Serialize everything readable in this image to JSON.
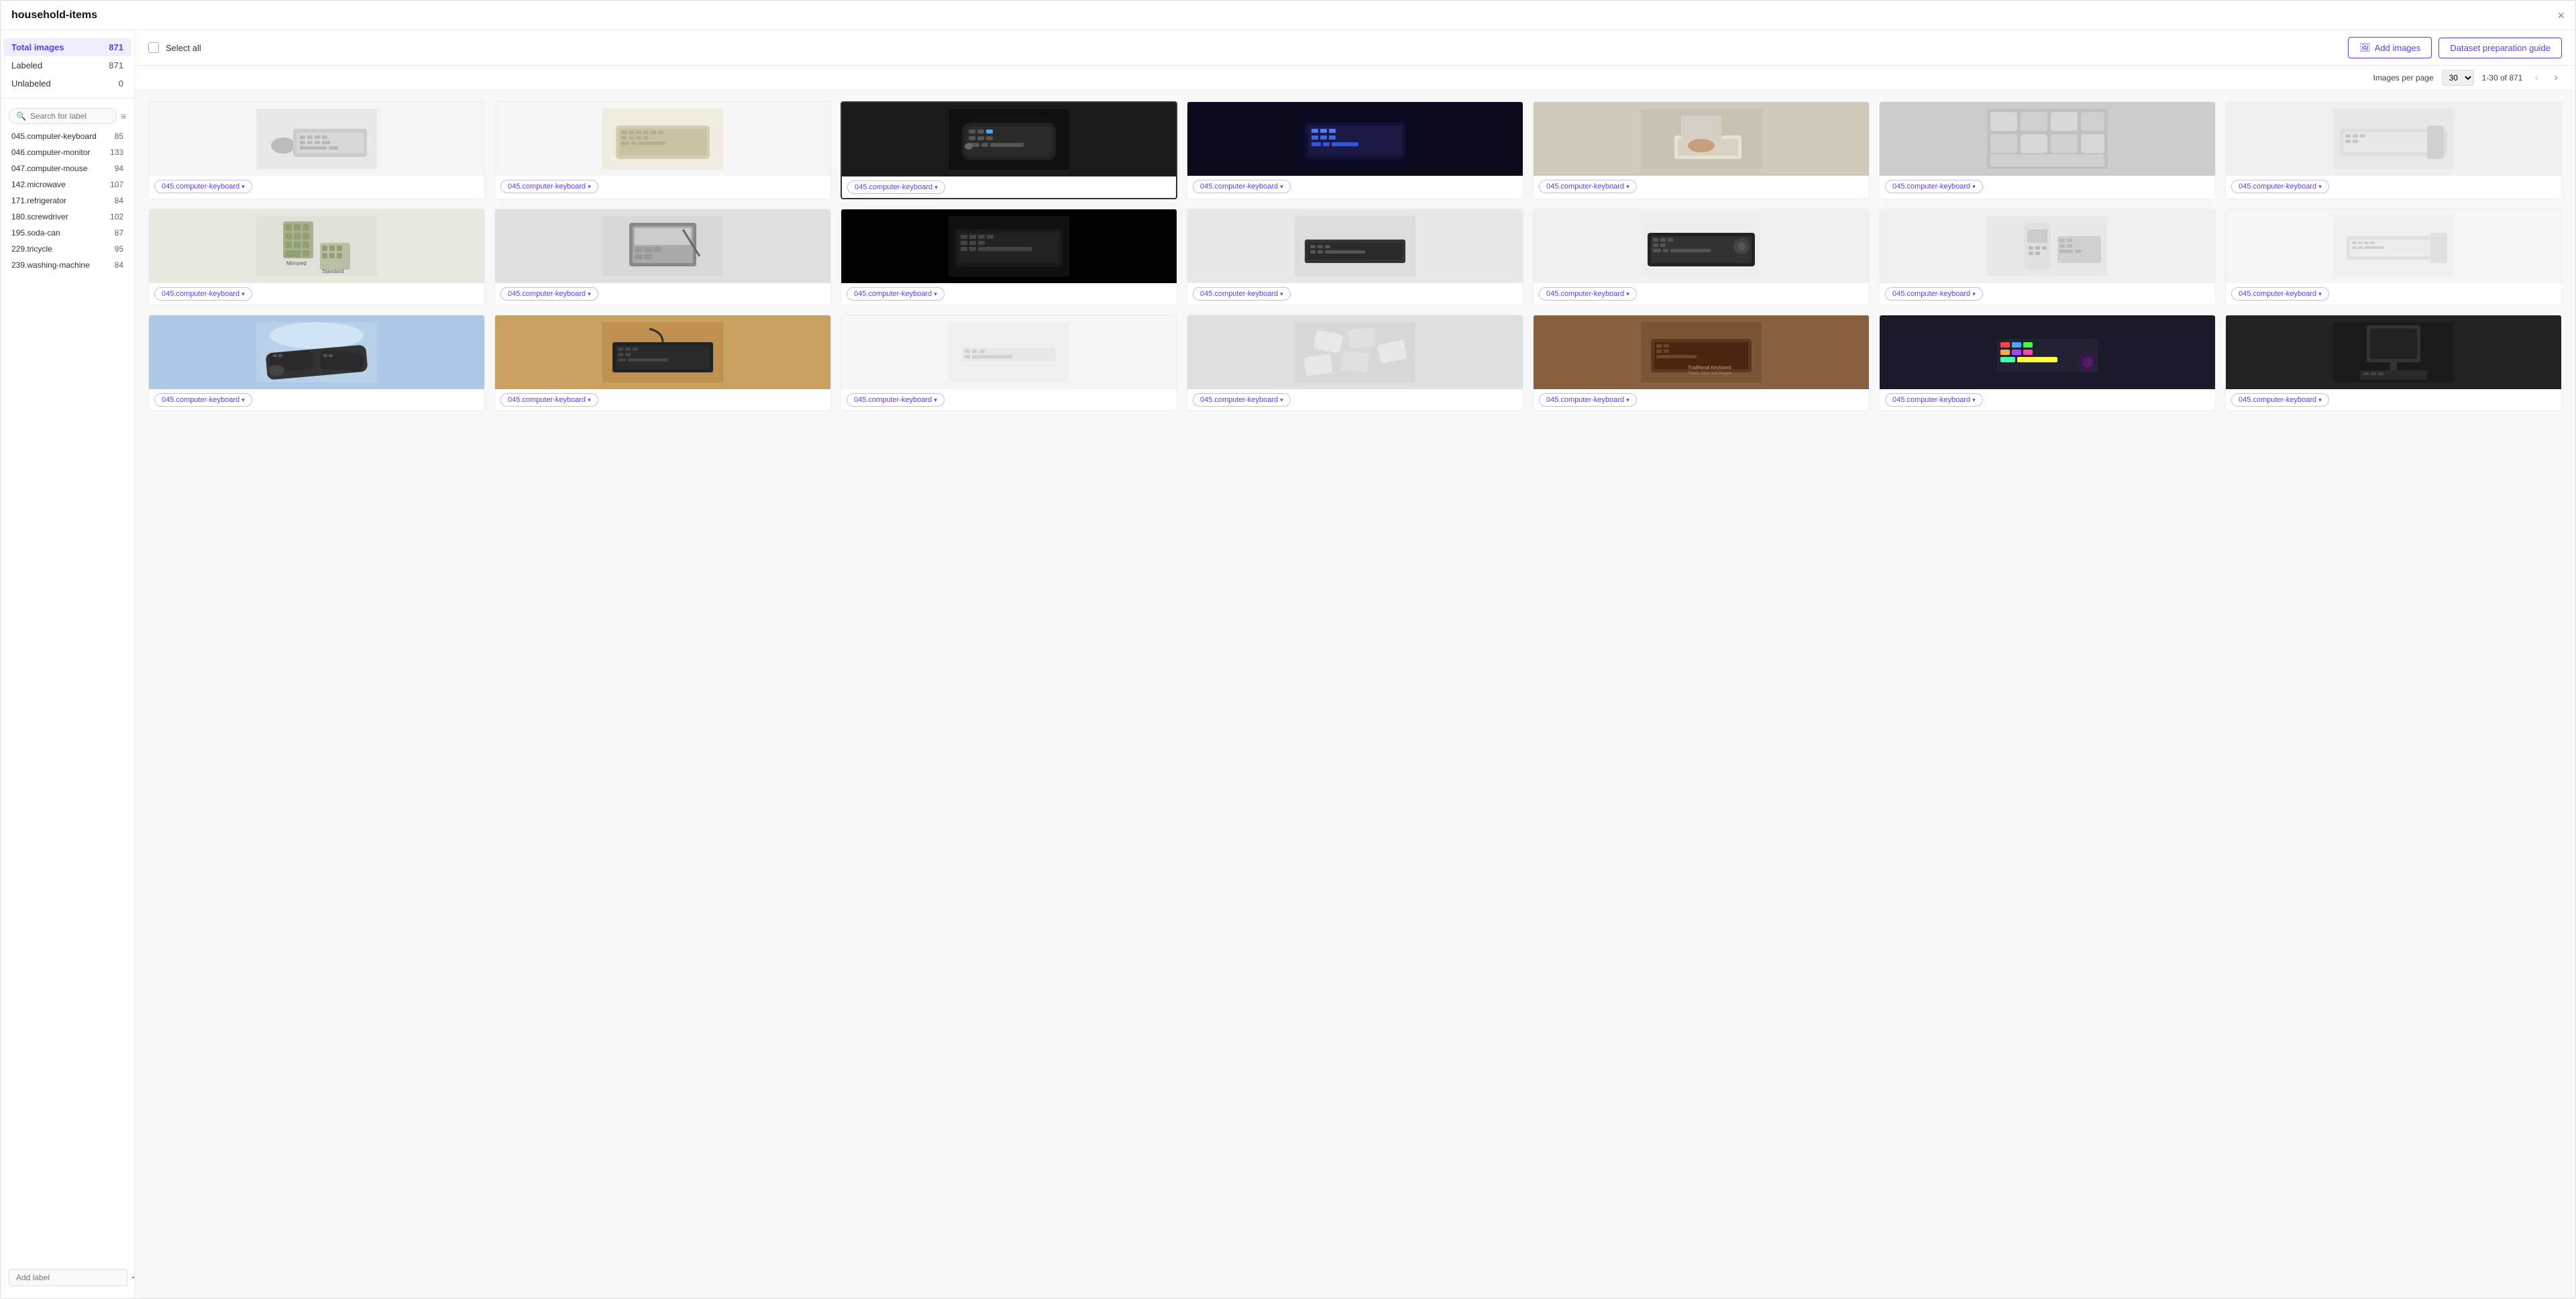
{
  "window": {
    "title": "household-items",
    "close_label": "×"
  },
  "sidebar": {
    "stats": [
      {
        "label": "Total images",
        "count": "871",
        "active": true
      },
      {
        "label": "Labeled",
        "count": "871",
        "active": false
      },
      {
        "label": "Unlabeled",
        "count": "0",
        "active": false
      }
    ],
    "search_placeholder": "Search for label",
    "labels": [
      {
        "name": "045.computer-keyboard",
        "count": "85"
      },
      {
        "name": "046.computer-monitor",
        "count": "133"
      },
      {
        "name": "047.computer-mouse",
        "count": "94"
      },
      {
        "name": "142.microwave",
        "count": "107"
      },
      {
        "name": "171.refrigerator",
        "count": "84"
      },
      {
        "name": "180.screwdriver",
        "count": "102"
      },
      {
        "name": "195.soda-can",
        "count": "87"
      },
      {
        "name": "229.tricycle",
        "count": "95"
      },
      {
        "name": "239.washing-machine",
        "count": "84"
      }
    ],
    "add_label_placeholder": "Add label"
  },
  "toolbar": {
    "select_all_label": "Select all",
    "add_images_label": "Add images",
    "dataset_guide_label": "Dataset preparation guide"
  },
  "pagination": {
    "per_page_label": "Images per page",
    "per_page_value": "30",
    "page_info": "1-30 of 871"
  },
  "images": {
    "label_tag": "045.computer-keyboard",
    "rows": [
      [
        {
          "id": 1,
          "desc": "keyboard-gray-side",
          "highlighted": false
        },
        {
          "id": 2,
          "desc": "keyboard-beige",
          "highlighted": false
        },
        {
          "id": 3,
          "desc": "keyboard-black-curved",
          "highlighted": true
        },
        {
          "id": 4,
          "desc": "keyboard-blue-lit",
          "highlighted": false
        },
        {
          "id": 5,
          "desc": "keyboard-person-typing",
          "highlighted": false
        },
        {
          "id": 6,
          "desc": "keyboard-keys-closeup",
          "highlighted": false
        },
        {
          "id": 7,
          "desc": "keyboard-white-side",
          "highlighted": false
        }
      ],
      [
        {
          "id": 8,
          "desc": "keyboard-mirrored-standard",
          "highlighted": false,
          "overlay": "Mirrored\nStandard"
        },
        {
          "id": 9,
          "desc": "keyboard-touchscreen",
          "highlighted": false
        },
        {
          "id": 10,
          "desc": "keyboard-black-lit",
          "highlighted": false
        },
        {
          "id": 11,
          "desc": "keyboard-black-sleek",
          "highlighted": false
        },
        {
          "id": 12,
          "desc": "keyboard-black-large",
          "highlighted": false
        },
        {
          "id": 13,
          "desc": "keyboard-white-phone",
          "highlighted": false
        },
        {
          "id": 14,
          "desc": "keyboard-small-white",
          "highlighted": false
        }
      ],
      [
        {
          "id": 15,
          "desc": "keyboard-ergonomic-blue",
          "highlighted": false
        },
        {
          "id": 16,
          "desc": "keyboard-black-wired",
          "highlighted": false
        },
        {
          "id": 17,
          "desc": "keyboard-white-slim",
          "highlighted": false
        },
        {
          "id": 18,
          "desc": "keyboard-keys-scattered",
          "highlighted": false
        },
        {
          "id": 19,
          "desc": "keyboard-brown-text",
          "highlighted": false
        },
        {
          "id": 20,
          "desc": "keyboard-colorful",
          "highlighted": false
        },
        {
          "id": 21,
          "desc": "keyboard-monitor-dark",
          "highlighted": false
        }
      ]
    ]
  },
  "colors": {
    "accent": "#5b3de8",
    "border": "#eee",
    "tag_border": "#c5b8f5",
    "active_bg": "#f0edff"
  }
}
